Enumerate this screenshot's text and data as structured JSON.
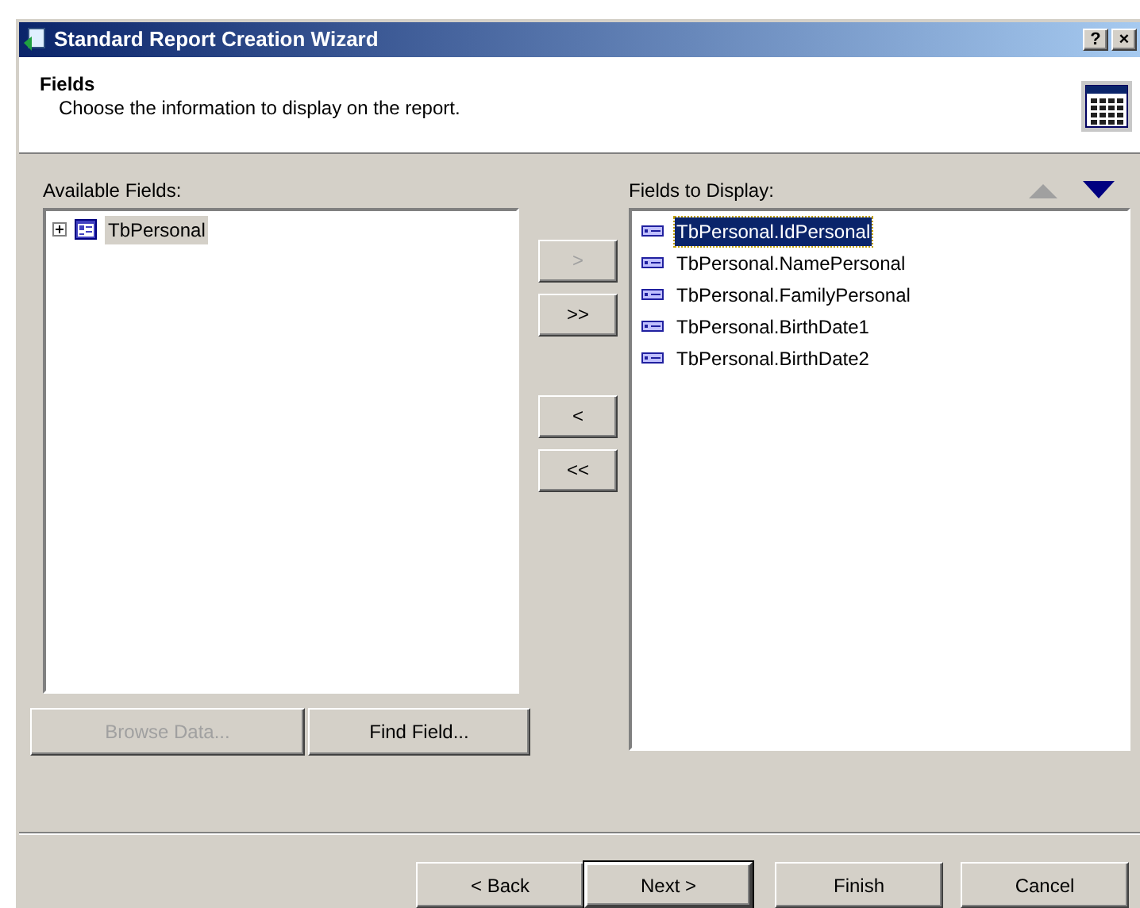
{
  "window": {
    "title": "Standard Report Creation Wizard",
    "controls": [
      "?",
      "×"
    ]
  },
  "header": {
    "title": "Fields",
    "subtitle": "Choose the information to display on the report."
  },
  "available_fields": {
    "label": "Available Fields:",
    "items": [
      {
        "label": "TbPersonal",
        "expanded": false,
        "selected": true
      }
    ]
  },
  "move_buttons": [
    {
      "label": ">",
      "disabled": true
    },
    {
      "label": ">>",
      "disabled": false
    },
    {
      "label": "<",
      "disabled": false
    },
    {
      "label": "<<",
      "disabled": false
    }
  ],
  "fields_to_display": {
    "label": "Fields to Display:",
    "move_up_disabled": true,
    "move_down_disabled": false,
    "items": [
      {
        "label": "TbPersonal.IdPersonal",
        "selected": true
      },
      {
        "label": "TbPersonal.NamePersonal",
        "selected": false
      },
      {
        "label": "TbPersonal.FamilyPersonal",
        "selected": false
      },
      {
        "label": "TbPersonal.BirthDate1",
        "selected": false
      },
      {
        "label": "TbPersonal.BirthDate2",
        "selected": false
      }
    ]
  },
  "list_buttons": [
    {
      "label": "Browse Data...",
      "disabled": true
    },
    {
      "label": "Find Field...",
      "disabled": false
    }
  ],
  "footer_buttons": [
    {
      "label": "< Back",
      "default": false
    },
    {
      "label": "Next >",
      "default": true
    },
    {
      "label": "Finish",
      "default": false
    },
    {
      "label": "Cancel",
      "default": false
    }
  ]
}
